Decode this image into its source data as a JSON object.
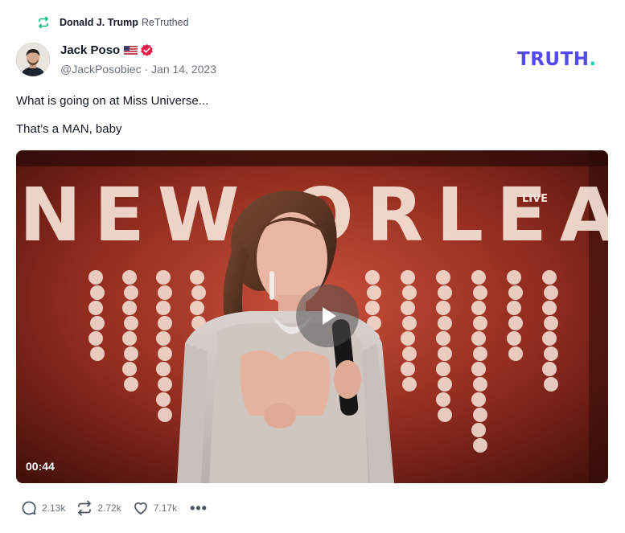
{
  "retruth": {
    "user": "Donald J. Trump",
    "action": "ReTruthed",
    "icon": "retruth-icon"
  },
  "post": {
    "author_name": "Jack Poso",
    "handle_date": "@JackPosobiec · Jan 14, 2023",
    "text_line1": "What is going on at Miss Universe...",
    "text_line2": "That’s a MAN, baby"
  },
  "brand": {
    "logo_text": "TRUTH",
    "logo_dot": ".",
    "color": "#5448ee",
    "dot_color": "#17d4b8"
  },
  "video": {
    "screen_text": "NEW ORLEA",
    "live_label": "LIVE",
    "duration": "00:44"
  },
  "actions": {
    "replies": "2.13k",
    "retruths": "2.72k",
    "likes": "7.17k",
    "more": "•••"
  }
}
